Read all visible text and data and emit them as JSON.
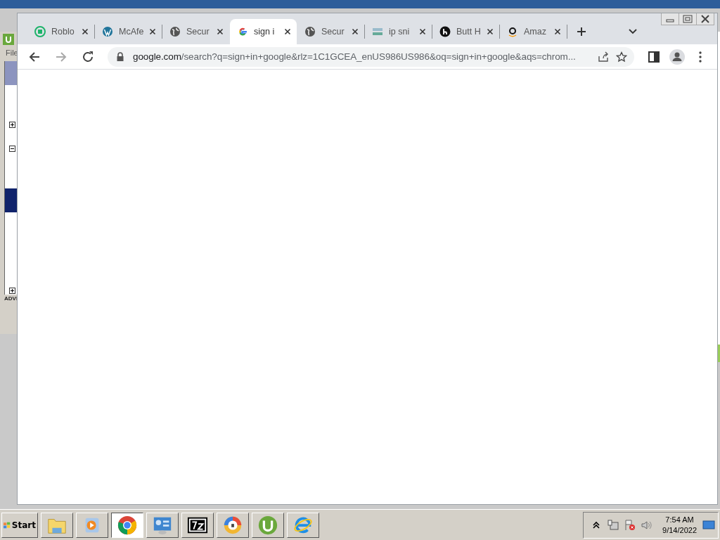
{
  "background_window": {
    "menu": "File",
    "label": "ADVI"
  },
  "browser": {
    "tabs": [
      {
        "kind": "roblox",
        "title": "Roblo",
        "selected": false
      },
      {
        "kind": "wordpress",
        "title": "McAfe",
        "selected": false
      },
      {
        "kind": "globe",
        "title": "Secur",
        "selected": false
      },
      {
        "kind": "google",
        "title": "sign i",
        "selected": true
      },
      {
        "kind": "globe",
        "title": "Secur",
        "selected": false
      },
      {
        "kind": "search",
        "title": "ip sni",
        "selected": false
      },
      {
        "kind": "letter",
        "title": "Butt H",
        "selected": false
      },
      {
        "kind": "amazon",
        "title": "Amaz",
        "selected": false
      }
    ],
    "address": {
      "host": "google.com",
      "path": "/search?q=sign+in+google&rlz=1C1GCEA_enUS986US986&oq=sign+in+google&aqs=chrom..."
    }
  },
  "taskbar": {
    "start": "Start",
    "apps": [
      {
        "kind": "folder",
        "selected": false
      },
      {
        "kind": "media",
        "selected": false
      },
      {
        "kind": "chrome",
        "selected": true
      },
      {
        "kind": "panel",
        "selected": false
      },
      {
        "kind": "sevenzip",
        "selected": false
      },
      {
        "kind": "vpn",
        "selected": false
      },
      {
        "kind": "torrent",
        "selected": false
      },
      {
        "kind": "ie",
        "selected": false
      }
    ],
    "clock": {
      "time": "7:54 AM",
      "date": "9/14/2022"
    }
  }
}
